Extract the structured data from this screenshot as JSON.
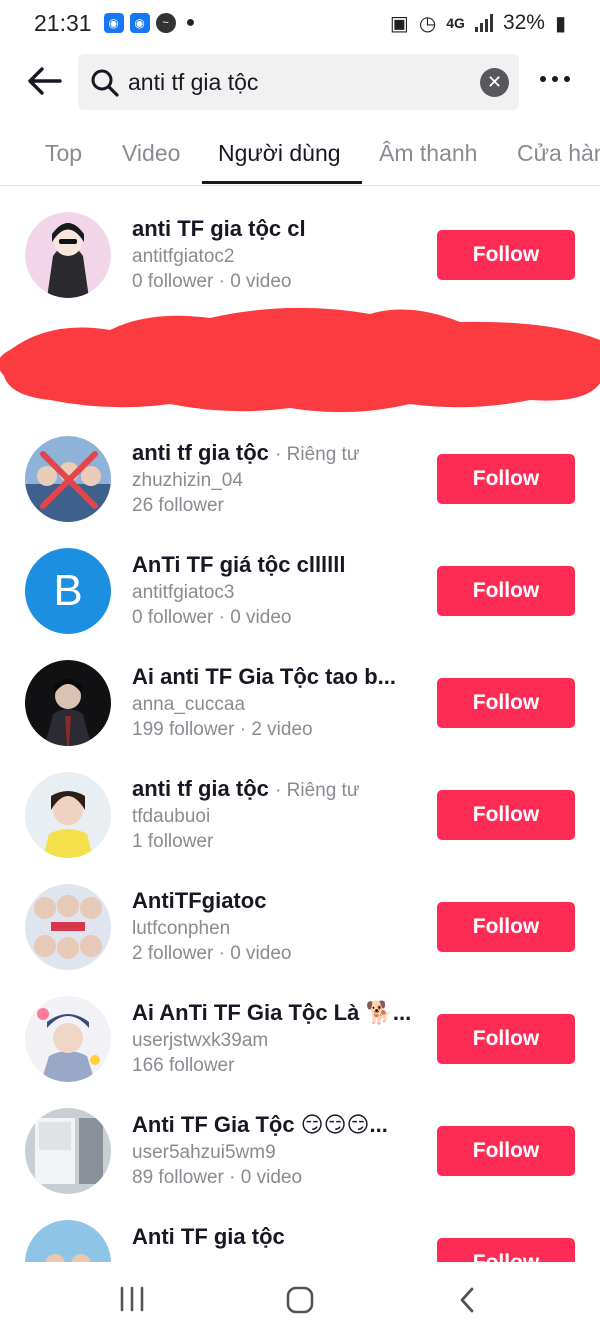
{
  "status_bar": {
    "time": "21:31",
    "network": "4G",
    "battery": "32%"
  },
  "search": {
    "query": "anti tf gia tộc"
  },
  "tabs": [
    {
      "label": "Top",
      "active": false
    },
    {
      "label": "Video",
      "active": false
    },
    {
      "label": "Người dùng",
      "active": true
    },
    {
      "label": "Âm thanh",
      "active": false
    },
    {
      "label": "Cửa hàng",
      "active": false
    }
  ],
  "users": [
    {
      "name": "anti TF gia tộc cl",
      "private_label": "",
      "handle": "antitfgiatoc2",
      "stats": "0 follower · 0 video",
      "follow_label": "Follow",
      "avatar": "anime-girl-avatar"
    },
    {
      "name": "anti tf gia tộc",
      "private_label": "· Riêng tư",
      "handle": "zhuzhizin_04",
      "stats": "26 follower",
      "follow_label": "Follow",
      "avatar": "group-photo-avatar"
    },
    {
      "name": "AnTi TF giá tộc cllllll",
      "private_label": "",
      "handle": "antitfgiatoc3",
      "stats": "0 follower · 0 video",
      "follow_label": "Follow",
      "avatar": "letter-avatar",
      "avatar_letter": "B"
    },
    {
      "name": "Ai anti TF Gia Tộc tao b...",
      "private_label": "",
      "handle": "anna_cuccaa",
      "stats": "199 follower · 2 video",
      "follow_label": "Follow",
      "avatar": "portrait-dark-avatar"
    },
    {
      "name": "anti tf gia tộc",
      "private_label": "· Riêng tư",
      "handle": "tfdaubuoi",
      "stats": "1 follower",
      "follow_label": "Follow",
      "avatar": "portrait-light-avatar"
    },
    {
      "name": "AntiTFgiatoc",
      "private_label": "",
      "handle": "lutfconphen",
      "stats": "2 follower · 0 video",
      "follow_label": "Follow",
      "avatar": "collage-avatar"
    },
    {
      "name": "Ai AnTi TF Gia Tộc Là 🐕...",
      "private_label": "",
      "handle": "userjstwxk39am",
      "stats": "166 follower",
      "follow_label": "Follow",
      "avatar": "portrait-hat-avatar"
    },
    {
      "name": "Anti TF Gia Tộc 😏😏😏...",
      "private_label": "",
      "handle": "user5ahzui5wm9",
      "stats": "89 follower · 0 video",
      "follow_label": "Follow",
      "avatar": "window-photo-avatar"
    },
    {
      "name": "Anti TF gia tộc",
      "private_label": "",
      "handle": "",
      "stats": "",
      "follow_label": "Follow",
      "avatar": "outdoor-photo-avatar"
    }
  ],
  "colors": {
    "follow": "#fe2c55",
    "redaction": "#fb3b3f"
  }
}
